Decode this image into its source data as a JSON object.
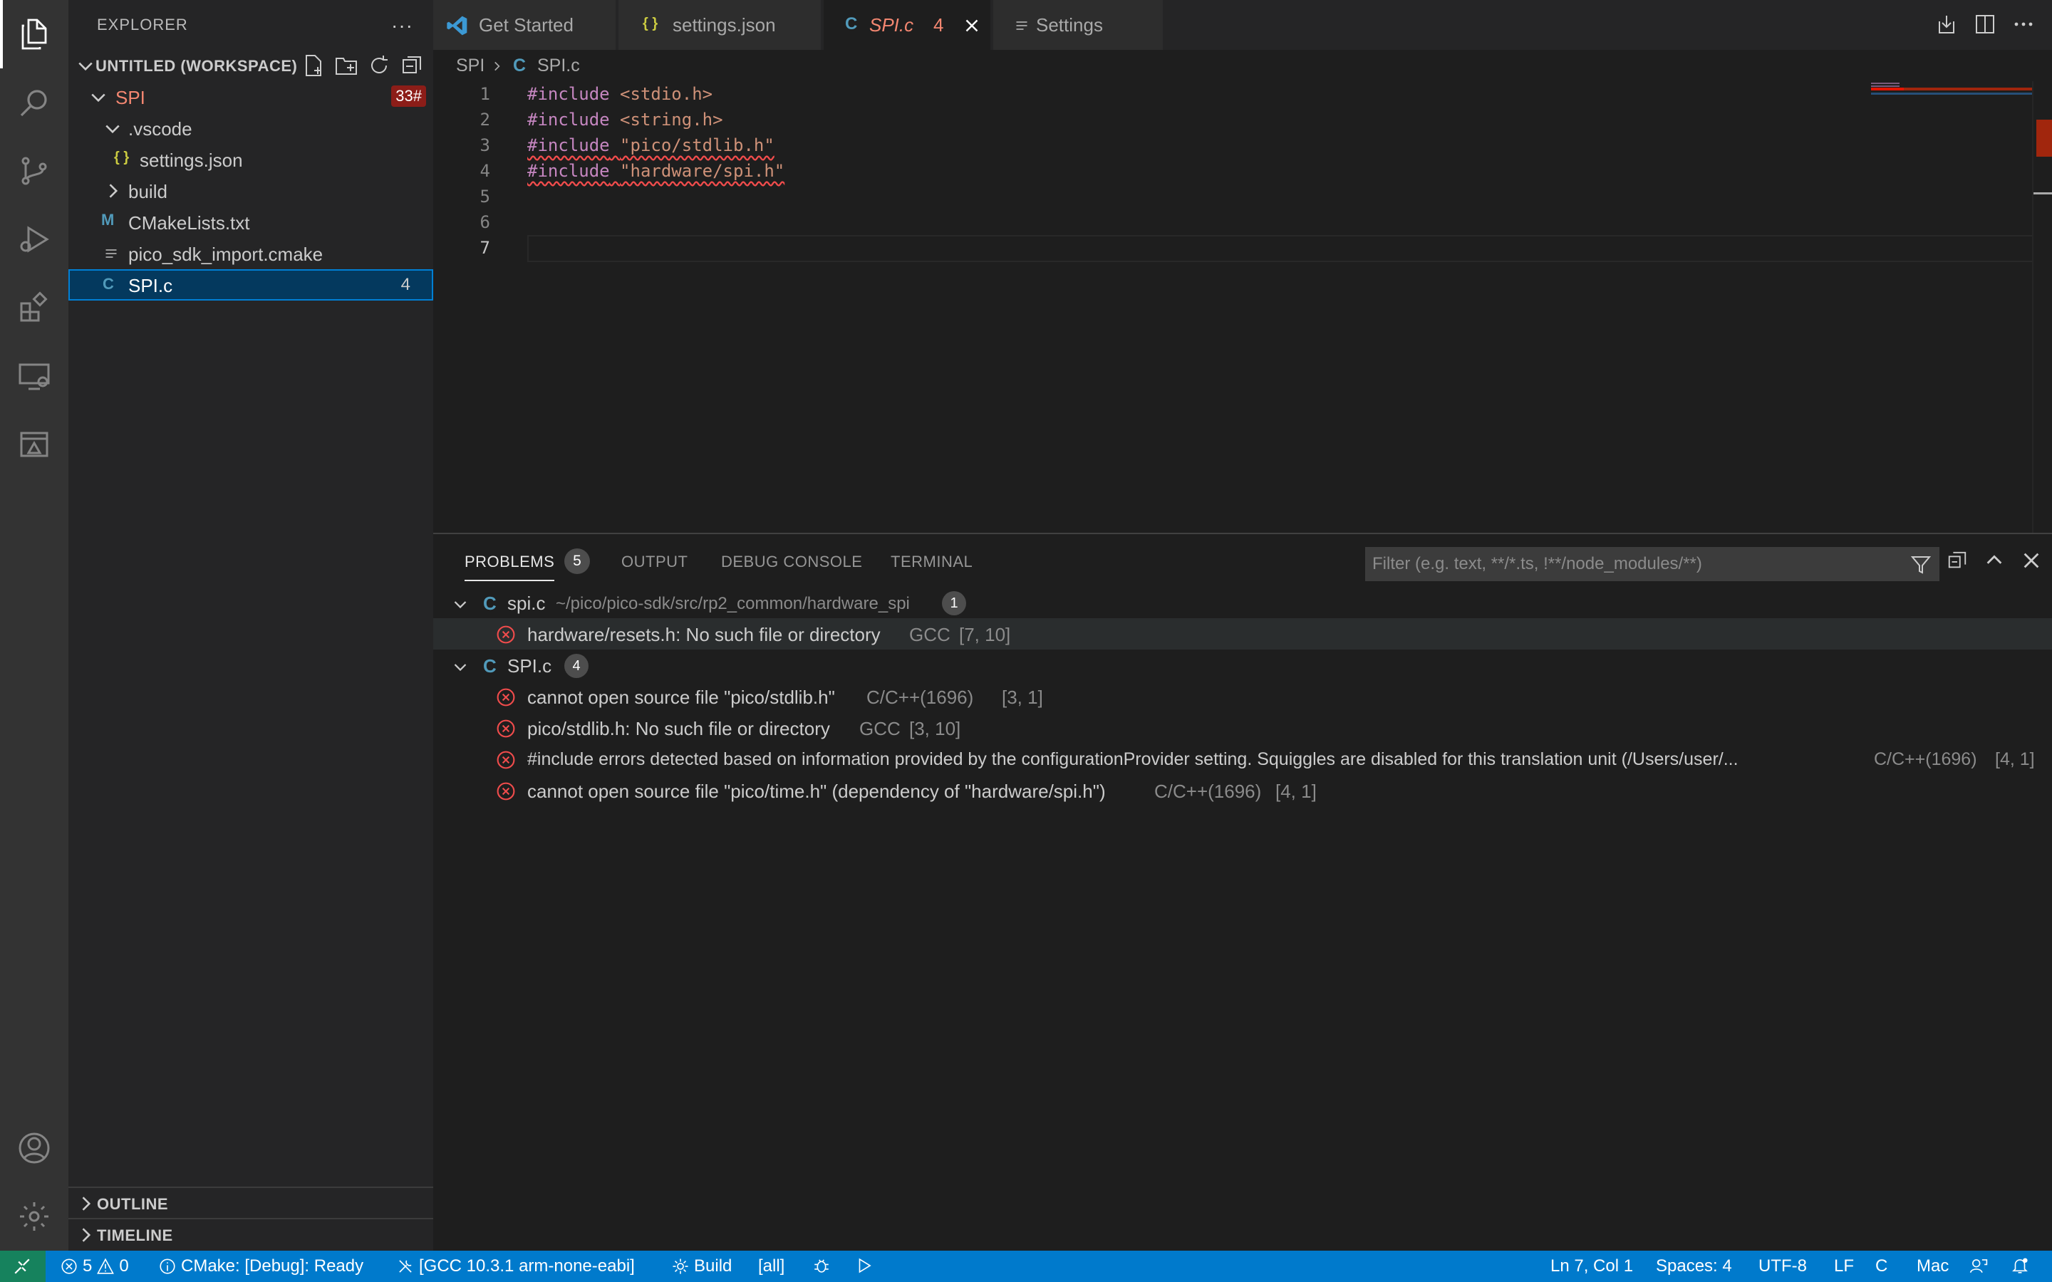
{
  "colors": {
    "accent": "#007acc",
    "error": "#f14c4c",
    "selection": "#04395e",
    "remote": "#16825d"
  },
  "activity_bar": {
    "top": [
      "files-icon",
      "search-icon",
      "source-control-icon",
      "run-debug-icon",
      "extensions-icon",
      "remote-explorer-icon",
      "cmake-icon"
    ],
    "bottom": [
      "account-icon",
      "manage-gear-icon"
    ]
  },
  "sidebar": {
    "title": "EXPLORER",
    "more": "···",
    "workspace": "UNTITLED (WORKSPACE)",
    "tree": {
      "spi": {
        "label": "SPI",
        "badge": "33#"
      },
      "vscode": {
        "label": ".vscode"
      },
      "settings": {
        "label": "settings.json",
        "icon": "{ }"
      },
      "build": {
        "label": "build"
      },
      "cmakelists": {
        "label": "CMakeLists.txt",
        "icon": "M"
      },
      "pico_sdk": {
        "label": "pico_sdk_import.cmake"
      },
      "spic": {
        "label": "SPI.c",
        "icon": "C",
        "count": "4"
      }
    },
    "outline": "OUTLINE",
    "timeline": "TIMELINE"
  },
  "tabs": [
    {
      "label": "Get Started"
    },
    {
      "label": "settings.json",
      "icon": "{ }"
    },
    {
      "label": "SPI.c",
      "icon": "C",
      "count": "4"
    },
    {
      "label": "Settings"
    }
  ],
  "breadcrumb": {
    "folder": "SPI",
    "icon": "C",
    "file": "SPI.c"
  },
  "editor": {
    "line_numbers": [
      "1",
      "2",
      "3",
      "4",
      "5",
      "6",
      "7"
    ],
    "lines": [
      {
        "kw": "#include",
        "arg": "<stdio.h>"
      },
      {
        "kw": "#include",
        "arg": "<string.h>"
      },
      {
        "kw": "#include",
        "arg": "\"pico/stdlib.h\""
      },
      {
        "kw": "#include",
        "arg": "\"hardware/spi.h\""
      }
    ]
  },
  "panel": {
    "tabs": {
      "problems": "PROBLEMS",
      "problems_count": "5",
      "output": "OUTPUT",
      "debug": "DEBUG CONSOLE",
      "terminal": "TERMINAL"
    },
    "filter_placeholder": "Filter (e.g. text, **/*.ts, !**/node_modules/**)",
    "groups": [
      {
        "icon": "C",
        "file": "spi.c",
        "path": "~/pico/pico-sdk/src/rp2_common/hardware_spi",
        "count": "1",
        "items": [
          {
            "msg": "hardware/resets.h: No such file or directory",
            "src": "GCC",
            "pos": "[7, 10]"
          }
        ]
      },
      {
        "icon": "C",
        "file": "SPI.c",
        "count": "4",
        "items": [
          {
            "msg": "cannot open source file \"pico/stdlib.h\"",
            "src": "C/C++(1696)",
            "pos": "[3, 1]"
          },
          {
            "msg": "pico/stdlib.h: No such file or directory",
            "src": "GCC",
            "pos": "[3, 10]"
          },
          {
            "msg": "#include errors detected based on information provided by the configurationProvider setting. Squiggles are disabled for this translation unit (/Users/user/...",
            "src": "C/C++(1696)",
            "pos": "[4, 1]"
          },
          {
            "msg": "cannot open source file \"pico/time.h\" (dependency of \"hardware/spi.h\")",
            "src": "C/C++(1696)",
            "pos": "[4, 1]"
          }
        ]
      }
    ]
  },
  "status": {
    "errors": "5",
    "warnings": "0",
    "cmake": "CMake: [Debug]: Ready",
    "kit": "[GCC 10.3.1 arm-none-eabi]",
    "build": "Build",
    "target": "[all]",
    "position": "Ln 7, Col 1",
    "spaces": "Spaces: 4",
    "encoding": "UTF-8",
    "eol": "LF",
    "language": "C",
    "platform": "Mac"
  }
}
